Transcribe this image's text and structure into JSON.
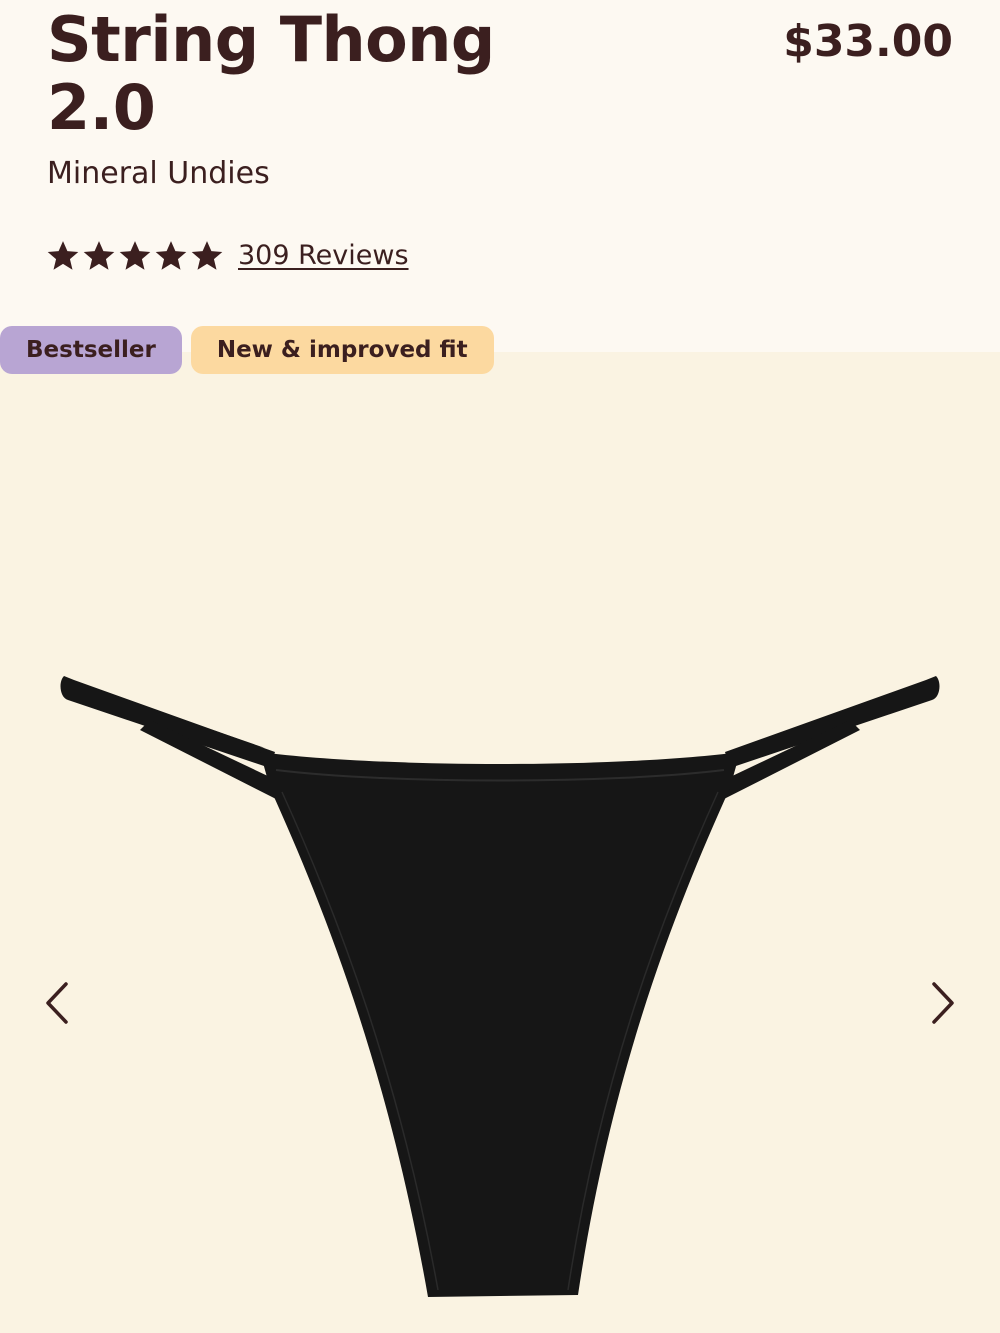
{
  "product": {
    "title": "String Thong 2.0",
    "price": "$33.00",
    "brand": "Mineral Undies",
    "rating": {
      "stars": 5,
      "reviews_label": "309 Reviews"
    },
    "badges": [
      "Bestseller",
      "New & improved fit"
    ]
  },
  "colors": {
    "text": "#3b1f1f",
    "header_bg": "#fdf9f2",
    "gallery_bg": "#faf3e2",
    "badge_bestseller": "#b8a5d3",
    "badge_new": "#fcd9a0",
    "product": "#161616"
  },
  "icons": {
    "star": "star-icon",
    "prev": "chevron-left-icon",
    "next": "chevron-right-icon"
  }
}
